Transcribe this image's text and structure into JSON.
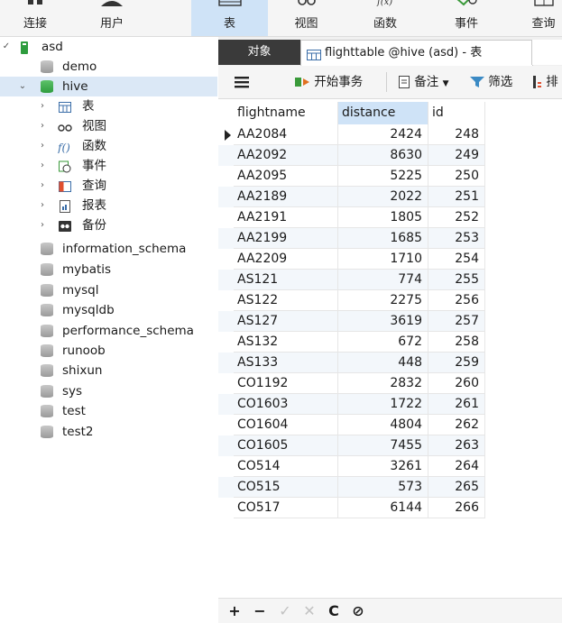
{
  "toolbar": {
    "buttons": [
      {
        "label": "连接",
        "icon": "connection-icon"
      },
      {
        "label": "用户",
        "icon": "user-icon"
      },
      {
        "label": "表",
        "icon": "table-icon",
        "active": true
      },
      {
        "label": "视图",
        "icon": "view-icon"
      },
      {
        "label": "函数",
        "icon": "function-icon"
      },
      {
        "label": "事件",
        "icon": "event-icon"
      },
      {
        "label": "查询",
        "icon": "query-icon"
      }
    ]
  },
  "tree": {
    "connection": "asd",
    "databases_before": [
      "demo"
    ],
    "open_db": "hive",
    "children": [
      {
        "label": "表",
        "icon": "table-icon"
      },
      {
        "label": "视图",
        "icon": "view-icon"
      },
      {
        "label": "函数",
        "icon": "function-icon"
      },
      {
        "label": "事件",
        "icon": "event-icon"
      },
      {
        "label": "查询",
        "icon": "query-icon"
      },
      {
        "label": "报表",
        "icon": "report-icon"
      },
      {
        "label": "备份",
        "icon": "backup-icon"
      }
    ],
    "databases_after": [
      "information_schema",
      "mybatis",
      "mysql",
      "mysqldb",
      "performance_schema",
      "runoob",
      "shixun",
      "sys",
      "test",
      "test2"
    ]
  },
  "tabs": {
    "objects": "对象",
    "table_tab": "flighttable @hive (asd) - 表"
  },
  "subtoolbar": {
    "menu": "menu-icon",
    "begin_transaction": "开始事务",
    "comment": "备注",
    "filter": "筛选",
    "sort": "排"
  },
  "grid": {
    "columns": [
      "flightname",
      "distance",
      "id"
    ],
    "selected_column": "distance",
    "rows": [
      [
        "AA2084",
        "2424",
        "248"
      ],
      [
        "AA2092",
        "8630",
        "249"
      ],
      [
        "AA2095",
        "5225",
        "250"
      ],
      [
        "AA2189",
        "2022",
        "251"
      ],
      [
        "AA2191",
        "1805",
        "252"
      ],
      [
        "AA2199",
        "1685",
        "253"
      ],
      [
        "AA2209",
        "1710",
        "254"
      ],
      [
        "AS121",
        "774",
        "255"
      ],
      [
        "AS122",
        "2275",
        "256"
      ],
      [
        "AS127",
        "3619",
        "257"
      ],
      [
        "AS132",
        "672",
        "258"
      ],
      [
        "AS133",
        "448",
        "259"
      ],
      [
        "CO1192",
        "2832",
        "260"
      ],
      [
        "CO1603",
        "1722",
        "261"
      ],
      [
        "CO1604",
        "4804",
        "262"
      ],
      [
        "CO1605",
        "7455",
        "263"
      ],
      [
        "CO514",
        "3261",
        "264"
      ],
      [
        "CO515",
        "573",
        "265"
      ],
      [
        "CO517",
        "6144",
        "266"
      ]
    ]
  },
  "footer": {
    "add": "+",
    "delete": "−",
    "apply": "✓",
    "discard": "✕",
    "refresh": "C",
    "stop": "⊘"
  },
  "colors": {
    "active_toolbar": "#cfe3f7",
    "selected_tree": "#dbe8f6",
    "db_green": "#2e9c3e",
    "tab_dark": "#3a3a3a"
  }
}
